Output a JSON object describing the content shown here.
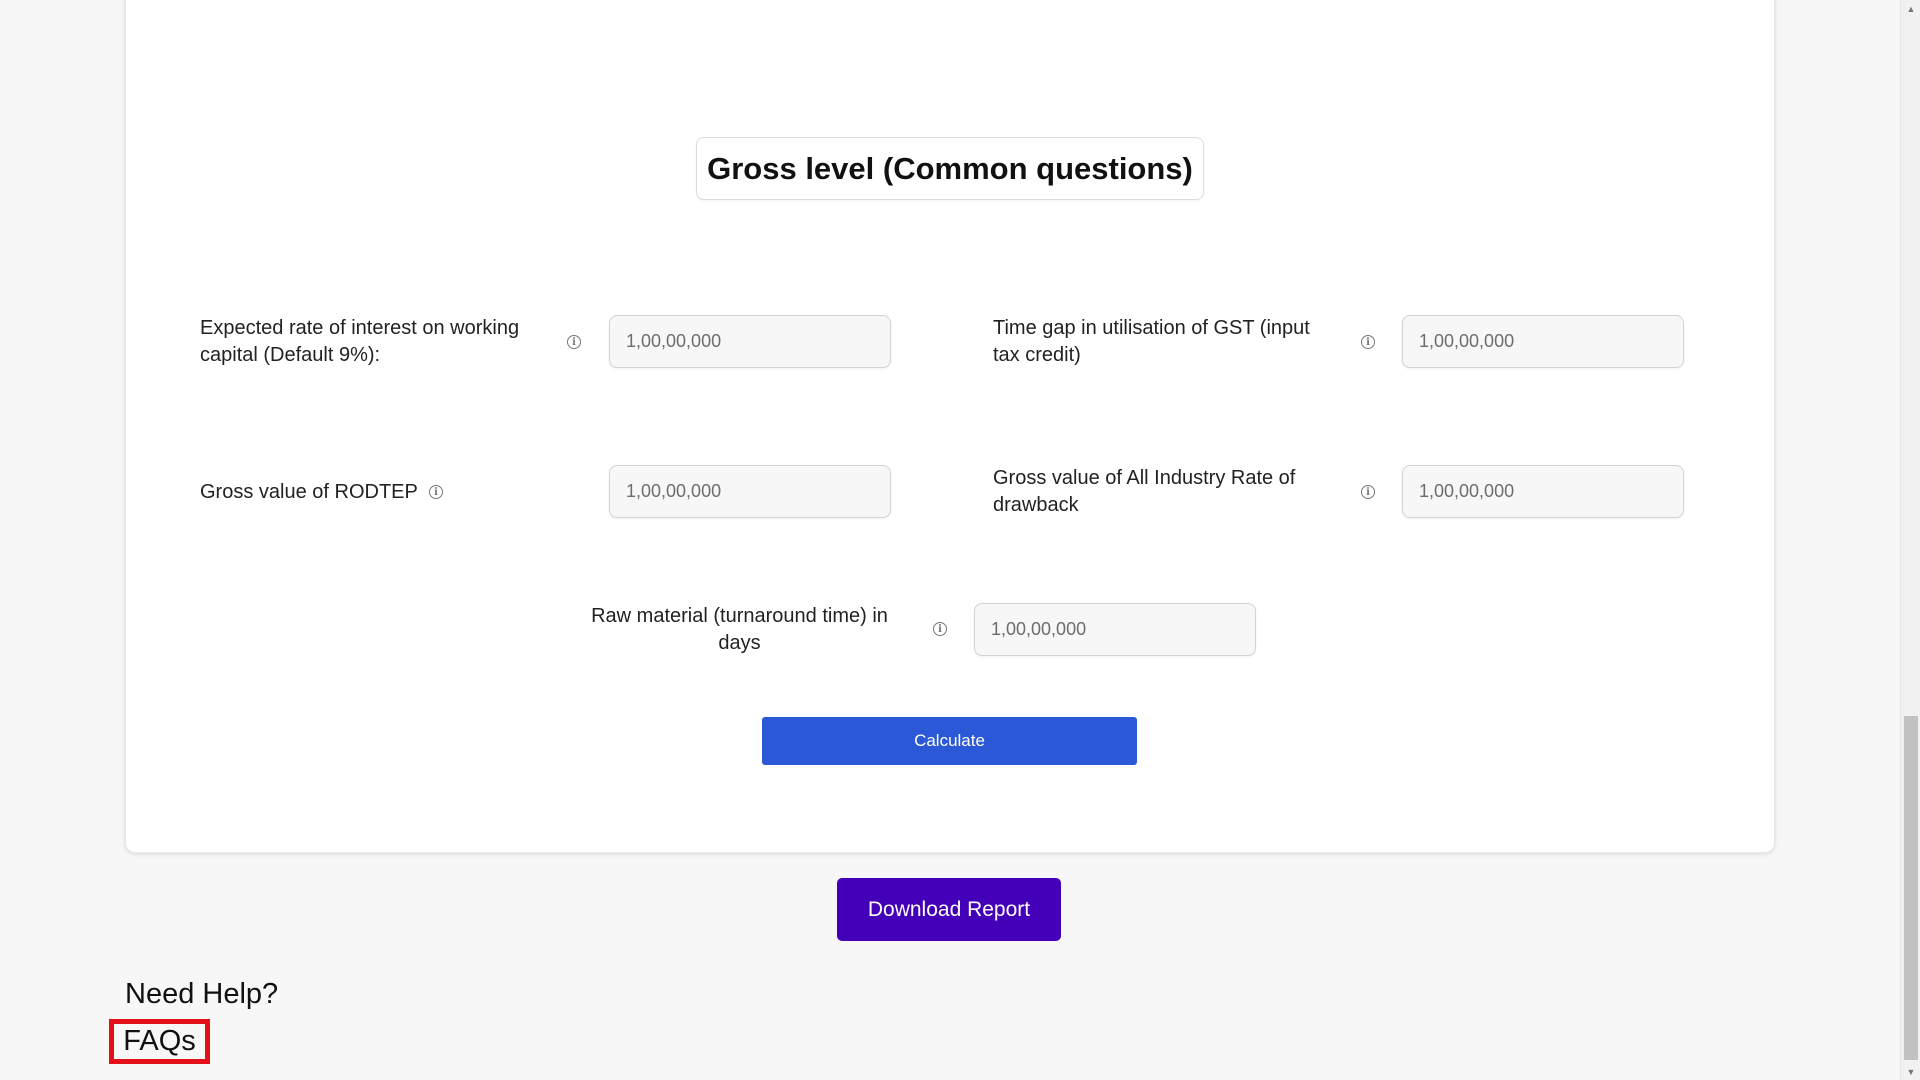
{
  "section": {
    "title": "Gross level (Common questions)"
  },
  "fields": [
    {
      "label": "Expected rate of interest on working capital (Default 9%):",
      "placeholder": "1,00,00,000"
    },
    {
      "label": "Time gap in utilisation of GST (input tax credit)",
      "placeholder": "1,00,00,000"
    },
    {
      "label": "Gross value of RODTEP",
      "placeholder": "1,00,00,000"
    },
    {
      "label": "Gross value of All Industry Rate of drawback",
      "placeholder": "1,00,00,000"
    },
    {
      "label": "Raw material (turnaround time) in days",
      "placeholder": "1,00,00,000"
    }
  ],
  "actions": {
    "calculate_label": "Calculate",
    "download_label": "Download Report"
  },
  "help": {
    "title": "Need Help?",
    "faq_label": "FAQs",
    "faq_highlight_color": "#e3101a"
  },
  "colors": {
    "calculate_button": "#2a58d6",
    "download_button": "#4300b8"
  },
  "icons": {
    "info": "info-icon"
  }
}
